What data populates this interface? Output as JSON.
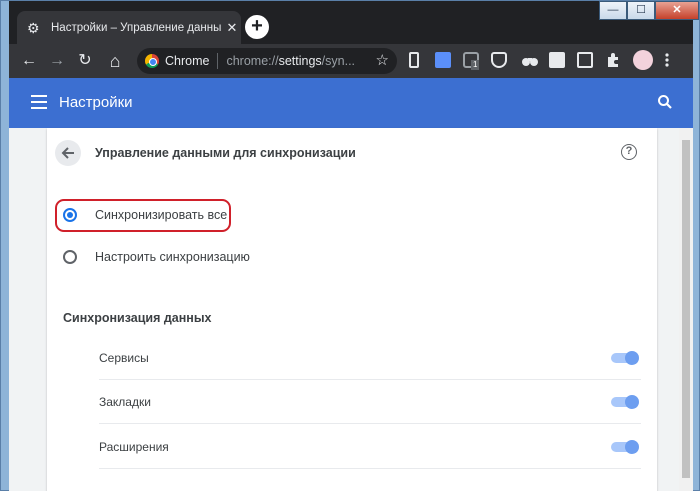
{
  "tab": {
    "title": "Настройки – Управление данны",
    "close_glyph": "✕",
    "gear_glyph": "⚙"
  },
  "new_tab_glyph": "+",
  "window_controls": {
    "minimize": "—",
    "maximize": "☐",
    "close": "✕"
  },
  "toolbar": {
    "site_chip": "Chrome",
    "url_prefix": "chrome://",
    "url_host": "settings",
    "url_rest": "/syn...",
    "star_glyph": "☆",
    "back_glyph": "←",
    "forward_glyph": "→",
    "reload_glyph": "↻",
    "home_glyph": "⌂",
    "ext_badge": "1"
  },
  "appbar": {
    "title": "Настройки"
  },
  "page": {
    "section_title": "Управление данными для синхронизации",
    "help_glyph": "?",
    "sync_all_label": "Синхронизировать все",
    "custom_sync_label": "Настроить синхронизацию",
    "data_heading": "Синхронизация данных",
    "items": [
      {
        "label": "Сервисы",
        "enabled": true
      },
      {
        "label": "Закладки",
        "enabled": true
      },
      {
        "label": "Расширения",
        "enabled": true
      }
    ]
  },
  "colors": {
    "appbar": "#3c6fd1",
    "accent": "#1a73e8",
    "highlight": "#d0202a"
  }
}
